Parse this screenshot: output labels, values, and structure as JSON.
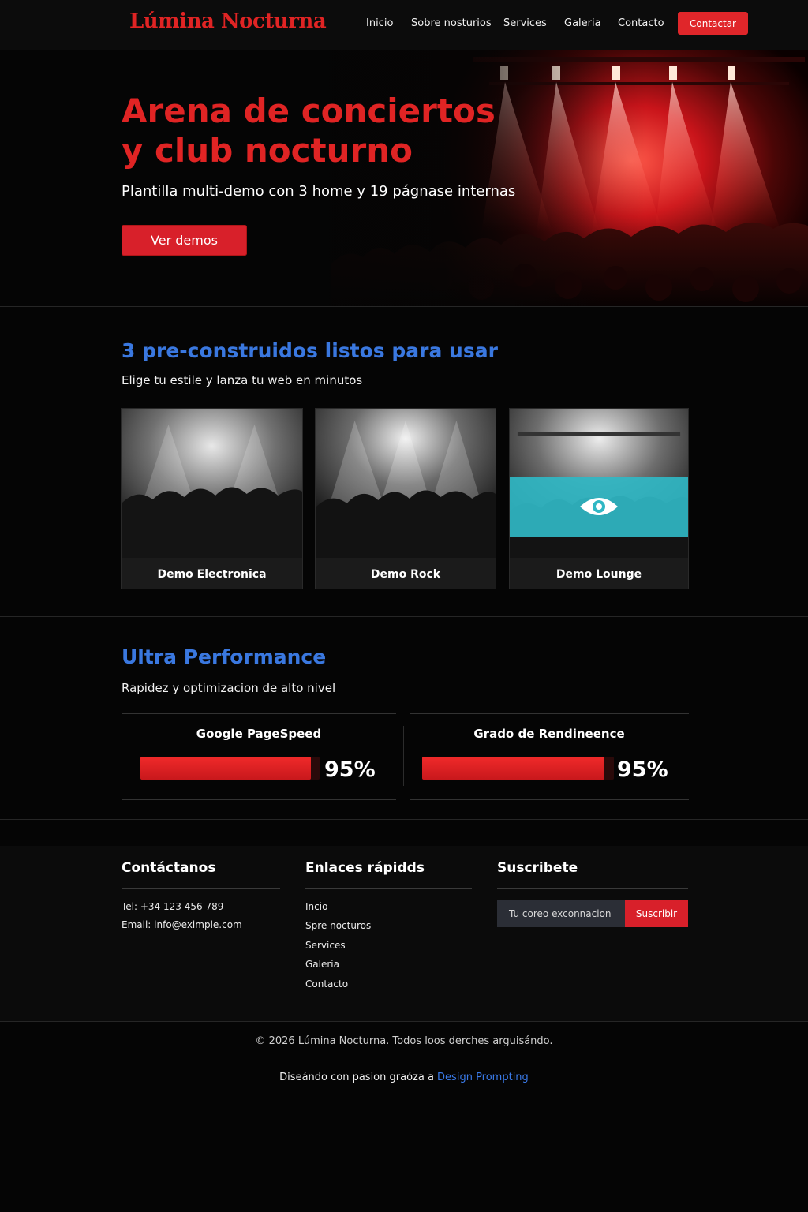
{
  "nav": {
    "logo": "Lúmina Nocturna",
    "links": [
      "Inicio",
      "Sobre nosturios",
      "Services",
      "Galeria",
      "Contacto"
    ],
    "cta": "Contactar"
  },
  "hero": {
    "title_line1": "Arena de conciertos",
    "title_line2": "y club nocturno",
    "subtitle": "Plantilla multi-demo con 3 home y 19 págnase internas",
    "button": "Ver demos"
  },
  "prebuilt": {
    "title": "3 pre-construidos listos para usar",
    "subtitle": "Elige tu estile y lanza tu web en minutos",
    "cards": [
      {
        "label": "Demo Electronica"
      },
      {
        "label": "Demo Rock"
      },
      {
        "label": "Demo Lounge"
      }
    ]
  },
  "performance": {
    "title": "Ultra Performance",
    "subtitle": "Rapidez y optimizacion de alto nivel",
    "metrics": [
      {
        "label": "Google PageSpeed",
        "value": 95,
        "display": "95%"
      },
      {
        "label": "Grado de Rendineence",
        "value": 95,
        "display": "95%"
      }
    ]
  },
  "footer": {
    "contact": {
      "heading": "Contáctanos",
      "phone": "Tel: +34 123 456 789",
      "email": "Email: info@eximple.com"
    },
    "links": {
      "heading": "Enlaces rápidds",
      "items": [
        "Incio",
        "Spre nocturos",
        "Services",
        "Galeria",
        "Contacto"
      ]
    },
    "subscribe": {
      "heading": "Suscribete",
      "placeholder": "Tu coreo exconnacion",
      "button": "Suscribir"
    }
  },
  "copyright": "© 2026 Lúmina Nocturna. Todos loos derches arguisándo.",
  "credit": {
    "prefix": "Diseándo con pasion graóza a ",
    "link": "Design Prompting"
  },
  "colors": {
    "accent_red": "#e02424",
    "heading_blue": "#3a78e0",
    "overlay_teal": "#30b7c4",
    "background": "#050505"
  },
  "icons": [
    "eye-icon"
  ]
}
